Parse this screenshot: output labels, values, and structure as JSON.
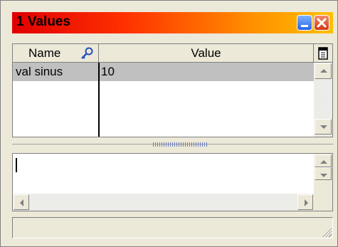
{
  "window": {
    "title": "1  Values",
    "title_colors": [
      "#e00000",
      "#ffc000"
    ]
  },
  "table": {
    "columns": [
      "Name",
      "Value"
    ],
    "rows": [
      {
        "name": "val sinus",
        "value": "10"
      }
    ],
    "selected_row_color": "#c0c0c0"
  },
  "editor": {
    "value": ""
  },
  "status": {
    "text": ""
  },
  "icons": {
    "search": "key-search-icon",
    "column_options": "column-options-icon",
    "minimize": "minimize-icon",
    "close": "close-icon"
  }
}
